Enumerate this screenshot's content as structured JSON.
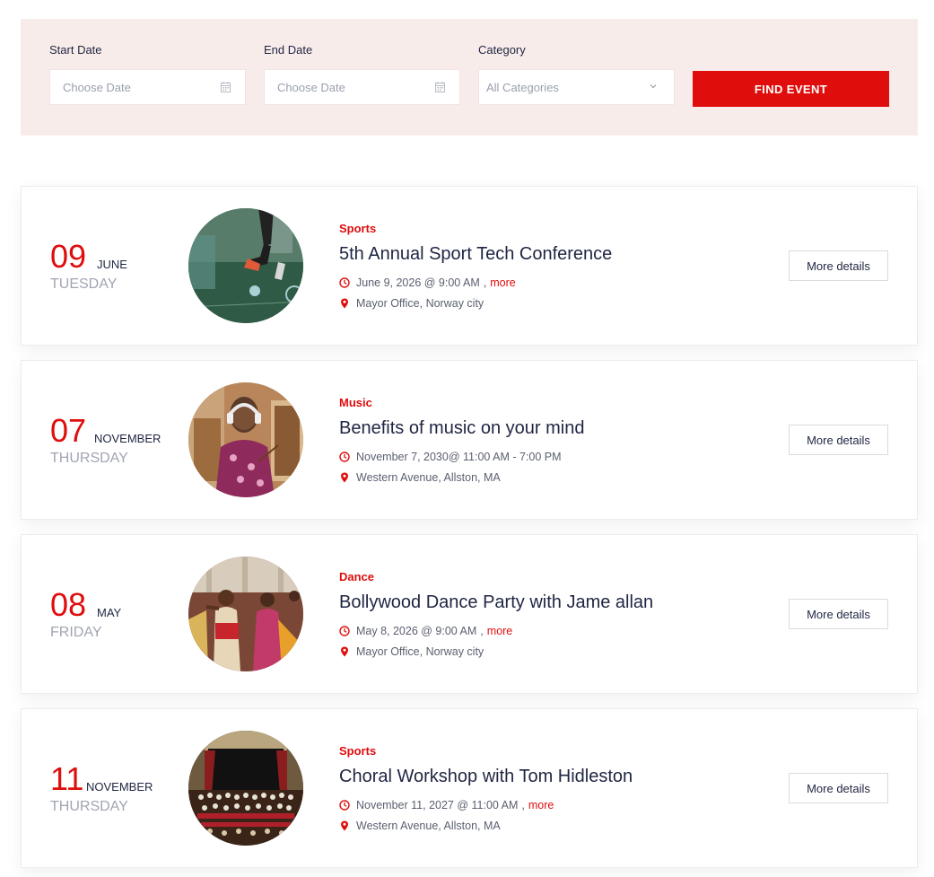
{
  "filters": {
    "start_label": "Start Date",
    "start_placeholder": "Choose Date",
    "end_label": "End Date",
    "end_placeholder": "Choose Date",
    "category_label": "Category",
    "category_value": "All Categories",
    "find_button": "FIND EVENT"
  },
  "colors": {
    "accent": "#e00d0d",
    "filter_bg": "#f8ecea",
    "text_dark": "#1f2542",
    "text_muted": "#a1a5b2"
  },
  "events": [
    {
      "day": "09",
      "month": "JUNE",
      "weekday": "TUESDAY",
      "category": "Sports",
      "title": "5th Annual Sport Tech Conference",
      "time": "June 9, 2026 @ 9:00 AM",
      "sep": ",",
      "more": "more",
      "location": "Mayor Office, Norway city",
      "button": "More details",
      "image": "soccer-player-image"
    },
    {
      "day": "07",
      "month": "NOVEMBER",
      "weekday": "THURSDAY",
      "category": "Music",
      "title": "Benefits of music on your mind",
      "time": "November 7, 2030@ 11:00 AM - 7:00 PM",
      "sep": "",
      "more": "",
      "location": "Western Avenue, Allston, MA",
      "button": "More details",
      "image": "woman-painting-image"
    },
    {
      "day": "08",
      "month": "MAY",
      "weekday": "FRIDAY",
      "category": "Dance",
      "title": "Bollywood Dance Party with Jame allan",
      "time": "May 8, 2026 @ 9:00 AM",
      "sep": ",",
      "more": "more",
      "location": "Mayor Office, Norway city",
      "button": "More details",
      "image": "dancers-image"
    },
    {
      "day": "11",
      "month": "NOVEMBER",
      "weekday": "THURSDAY",
      "category": "Sports",
      "title": "Choral Workshop with Tom Hidleston",
      "time": "November 11, 2027 @ 11:00 AM",
      "sep": ",",
      "more": "more",
      "location": "Western Avenue, Allston, MA",
      "button": "More details",
      "image": "choir-stage-image"
    }
  ]
}
